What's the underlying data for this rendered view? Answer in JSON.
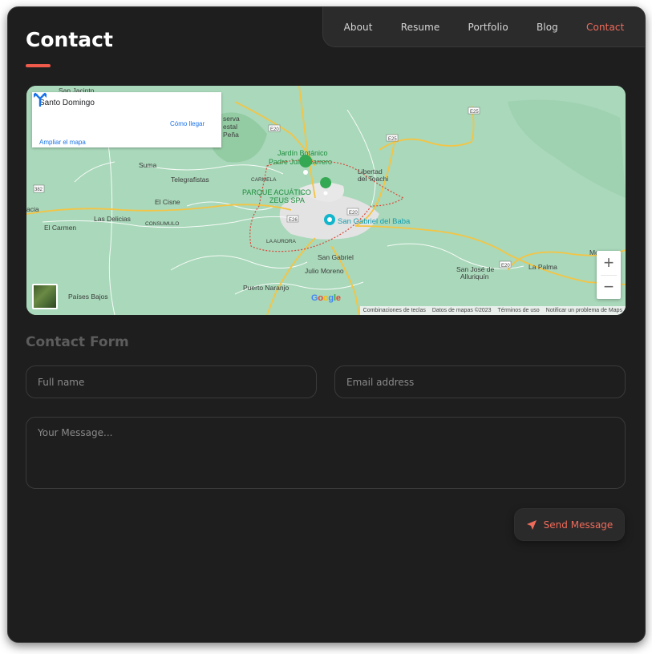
{
  "nav": {
    "items": [
      {
        "label": "About",
        "active": false
      },
      {
        "label": "Resume",
        "active": false
      },
      {
        "label": "Portfolio",
        "active": false
      },
      {
        "label": "Blog",
        "active": false
      },
      {
        "label": "Contact",
        "active": true
      }
    ]
  },
  "page": {
    "title": "Contact"
  },
  "map": {
    "place_name": "Santo Domingo",
    "directions_label": "Cómo llegar",
    "enlarge_label": "Ampliar el mapa",
    "zoom_in": "+",
    "zoom_out": "−",
    "google_logo": "Google",
    "footer": {
      "shortcuts": "Combinaciones de teclas",
      "map_data": "Datos de mapas ©2023",
      "terms": "Términos de uso",
      "report": "Notificar un problema de Maps"
    },
    "labels": {
      "san_jacinto": "San Jacinto",
      "reserva_1": "serva",
      "reserva_2": "estal",
      "reserva_3": "Peña",
      "suma": "Suma",
      "telegrafistas": "Telegrafistas",
      "el_cisne": "El Cisne",
      "las_delicias": "Las Delicias",
      "consumulo": "CONSUMULO",
      "el_carmen": "El Carmen",
      "jardin_1": "Jardín Botánico",
      "jardin_2": "Padre Julio Marrero",
      "libertad_1": "Libertad",
      "libertad_2": "del Toachi",
      "carmela": "CARMELA",
      "parque_1": "PARQUE ACUÁTICO",
      "parque_2": "ZEUS SPA",
      "san_gabriel_baba": "San Gabriel del Baba",
      "la_aurora": "LA AURORA",
      "san_gabriel": "San Gabriel",
      "julio_moreno": "Julio Moreno",
      "puerto_naranjo": "Puerto Naranjo",
      "paises_bajos": "Países Bajos",
      "san_jose_1": "San José de",
      "san_jose_2": "Alluriquín",
      "la_palma": "La Palma",
      "mo": "Mo",
      "cia": "acia",
      "road_e20": "E20",
      "road_e25": "E25",
      "road_e26": "E26",
      "road_382": "382"
    }
  },
  "form": {
    "section_title": "Contact Form",
    "fullname_placeholder": "Full name",
    "email_placeholder": "Email address",
    "message_placeholder": "Your Message...",
    "send_label": "Send Message"
  },
  "colors": {
    "accent": "#ef6b5a",
    "background": "#1e1e1f",
    "nav_background": "#2b2b2c"
  }
}
